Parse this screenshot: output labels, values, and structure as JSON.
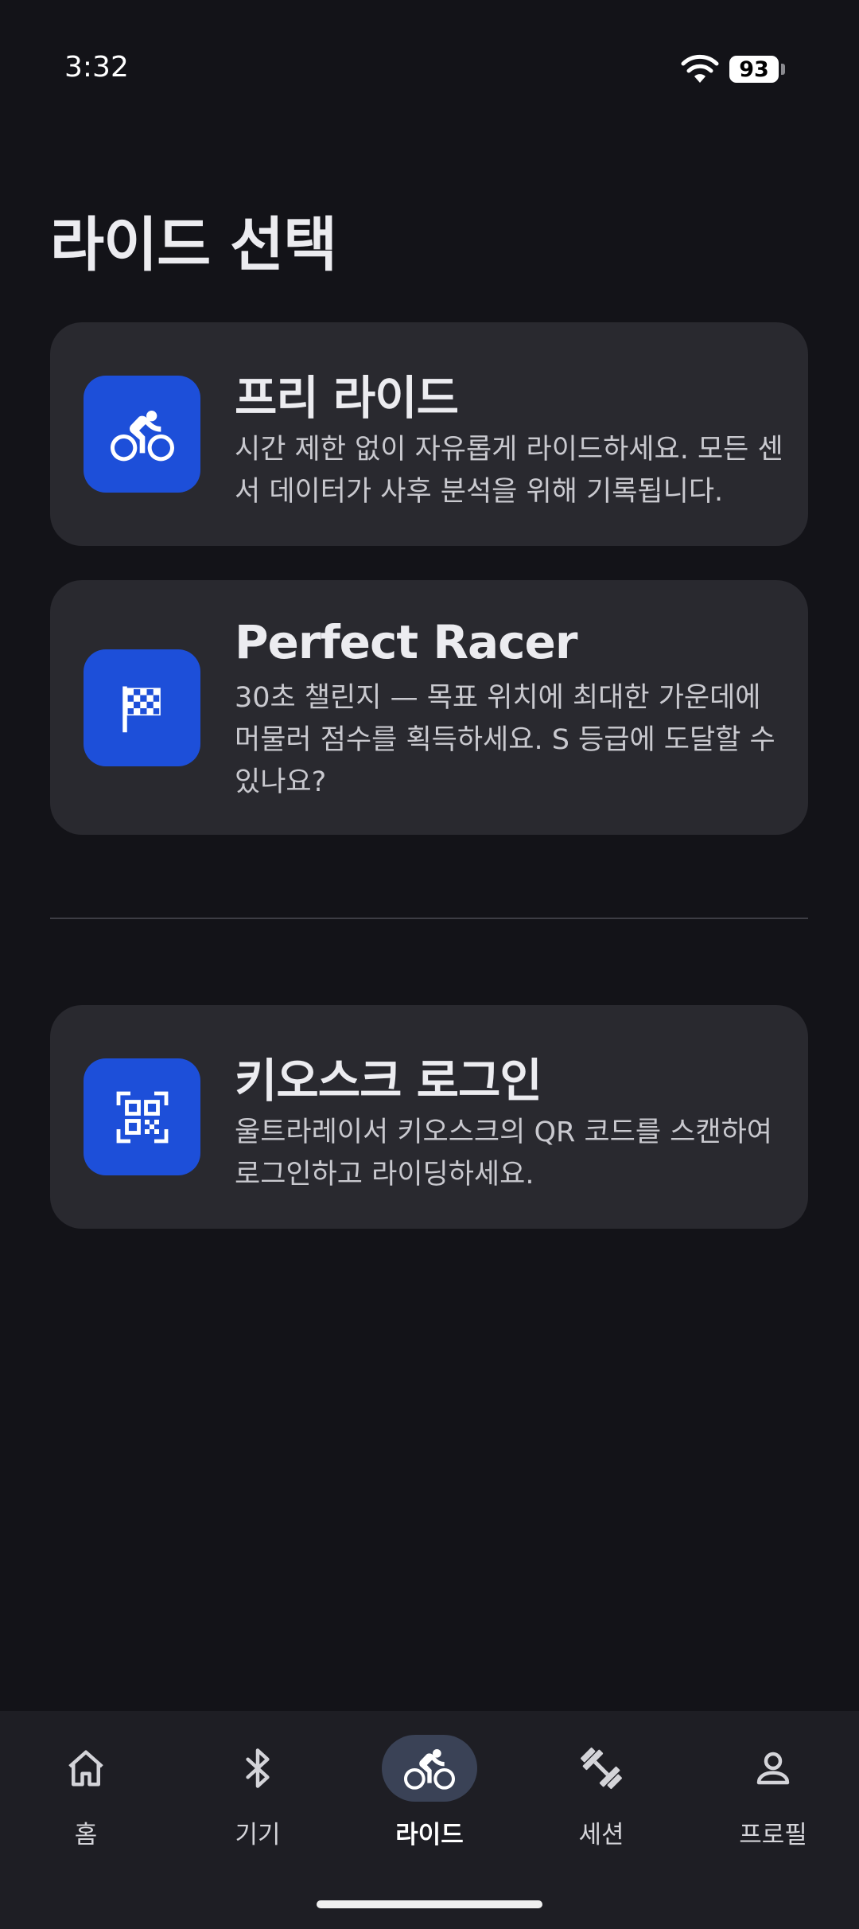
{
  "status_bar": {
    "time": "3:32",
    "battery": "93"
  },
  "page": {
    "title": "라이드 선택"
  },
  "cards": [
    {
      "title": "프리 라이드",
      "description": "시간 제한 없이 자유롭게 라이드하세요. 모든 센서 데이터가 사후 분석을 위해 기록됩니다.",
      "icon": "bike-icon"
    },
    {
      "title": "Perfect Racer",
      "description": "30초 챌린지 — 목표 위치에 최대한 가운데에 머물러 점수를 획득하세요. S 등급에 도달할 수 있나요?",
      "icon": "checkered-flag-icon"
    },
    {
      "title": "키오스크 로그인",
      "description": "울트라레이서 키오스크의 QR 코드를 스캔하여 로그인하고 라이딩하세요.",
      "icon": "qr-code-icon"
    }
  ],
  "nav": [
    {
      "label": "홈",
      "icon": "home-icon",
      "active": false
    },
    {
      "label": "기기",
      "icon": "bluetooth-icon",
      "active": false
    },
    {
      "label": "라이드",
      "icon": "bike-icon",
      "active": true
    },
    {
      "label": "세션",
      "icon": "dumbbell-icon",
      "active": false
    },
    {
      "label": "프로필",
      "icon": "person-icon",
      "active": false
    }
  ],
  "colors": {
    "background": "#131318",
    "card": "#29292f",
    "accent": "#1d4fd9",
    "nav_active_pill": "#3a4256"
  }
}
